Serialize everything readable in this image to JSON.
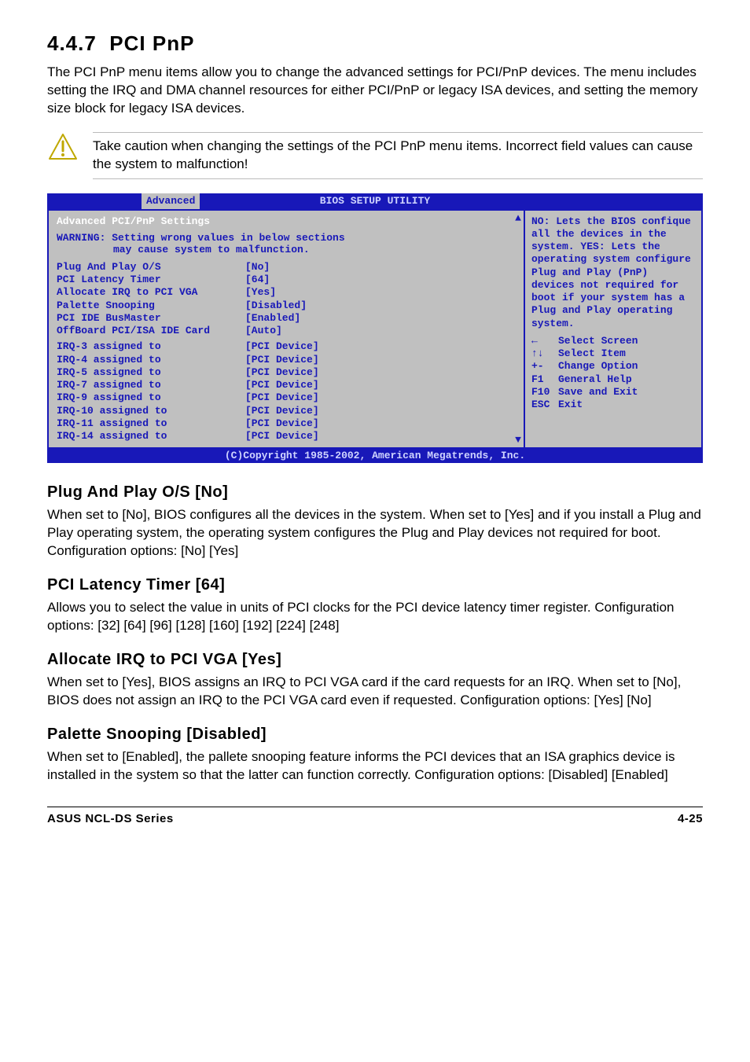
{
  "header": {
    "section_no": "4.4.7",
    "section_title": "PCI PnP",
    "intro": "The PCI PnP menu items allow you to change the advanced settings for PCI/PnP devices. The menu includes setting the IRQ and DMA channel resources for either PCI/PnP or legacy ISA devices, and setting the memory size block for legacy ISA devices."
  },
  "caution": "Take caution when changing the settings of the PCI PnP menu items. Incorrect field values can cause the system to malfunction!",
  "bios": {
    "topbar_title": "BIOS SETUP UTILITY",
    "active_tab": "Advanced",
    "left_heading": "Advanced PCI/PnP Settings",
    "warning_line1": "WARNING: Setting wrong values in below sections",
    "warning_line2": "may cause system to malfunction.",
    "rows1": [
      {
        "label": "Plug And Play O/S",
        "val": "[No]"
      },
      {
        "label": "PCI Latency Timer",
        "val": "[64]"
      },
      {
        "label": "Allocate IRQ to PCI VGA",
        "val": "[Yes]"
      },
      {
        "label": "Palette Snooping",
        "val": "[Disabled]"
      },
      {
        "label": "PCI IDE BusMaster",
        "val": "[Enabled]"
      },
      {
        "label": "OffBoard PCI/ISA IDE Card",
        "val": "[Auto]"
      }
    ],
    "rows2": [
      {
        "label": "IRQ-3 assigned to",
        "val": "[PCI Device]"
      },
      {
        "label": "IRQ-4 assigned to",
        "val": "[PCI Device]"
      },
      {
        "label": "IRQ-5 assigned to",
        "val": "[PCI Device]"
      },
      {
        "label": "IRQ-7 assigned to",
        "val": "[PCI Device]"
      },
      {
        "label": "IRQ-9 assigned to",
        "val": "[PCI Device]"
      },
      {
        "label": "IRQ-10 assigned to",
        "val": "[PCI Device]"
      },
      {
        "label": "IRQ-11 assigned to",
        "val": "[PCI Device]"
      },
      {
        "label": "IRQ-14 assigned to",
        "val": "[PCI Device]"
      }
    ],
    "help_text": "NO: Lets the BIOS confique all the devices in the system. YES: Lets the operating system configure Plug and Play (PnP) devices not required for boot if your system has a Plug and Play operating system.",
    "keys": [
      {
        "sym": "←",
        "txt": "Select Screen"
      },
      {
        "sym": "↑↓",
        "txt": "Select Item"
      },
      {
        "sym": "+-",
        "txt": "Change Option"
      },
      {
        "sym": "F1",
        "txt": "General Help"
      },
      {
        "sym": "F10",
        "txt": "Save and Exit"
      },
      {
        "sym": "ESC",
        "txt": "Exit"
      }
    ],
    "scroll_up": "▲",
    "scroll_down": "▼",
    "footer": "(C)Copyright 1985-2002, American Megatrends, Inc."
  },
  "subsections": [
    {
      "title": "Plug And Play O/S [No]",
      "body": "When set to [No], BIOS configures all the devices in the system. When set to [Yes] and if you install a Plug and Play operating system, the operating system configures the Plug and Play devices not required for boot. Configuration options: [No] [Yes]"
    },
    {
      "title": "PCI Latency Timer [64]",
      "body": "Allows you to select the value in units of PCI clocks for the PCI device latency timer register. Configuration options: [32] [64] [96] [128] [160] [192] [224] [248]"
    },
    {
      "title": "Allocate IRQ to PCI VGA [Yes]",
      "body": "When set to [Yes], BIOS assigns an IRQ to PCI VGA card if the card requests for an IRQ. When set to [No], BIOS does not assign an IRQ to the PCI VGA card even if requested. Configuration options: [Yes] [No]"
    },
    {
      "title": "Palette Snooping [Disabled]",
      "body": "When set to [Enabled], the pallete snooping feature informs the PCI devices that an ISA graphics device is installed in the system so that the latter can function correctly. Configuration options: [Disabled] [Enabled]"
    }
  ],
  "footer": {
    "left": "ASUS NCL-DS Series",
    "right": "4-25"
  }
}
